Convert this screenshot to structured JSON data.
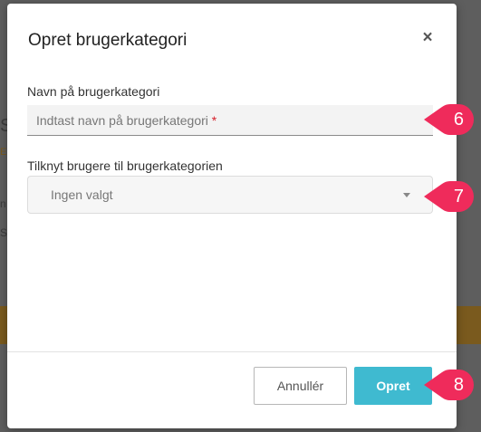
{
  "dialog": {
    "title": "Opret brugerkategori",
    "close_glyph": "×",
    "name_label": "Navn på brugerkategori",
    "name_placeholder": "Indtast navn på brugerkategori",
    "required_marker": "*",
    "users_label": "Tilknyt brugere til brugerkategorien",
    "users_selected": "Ingen valgt",
    "cancel_label": "Annullér",
    "create_label": "Opret"
  },
  "badges": [
    "6",
    "7",
    "8"
  ],
  "background": {
    "fragments": [
      "S",
      "E",
      "n",
      "S"
    ]
  },
  "colors": {
    "accent": "#3fbad0",
    "badge": "#ef2b5b",
    "required": "#d6202b"
  }
}
